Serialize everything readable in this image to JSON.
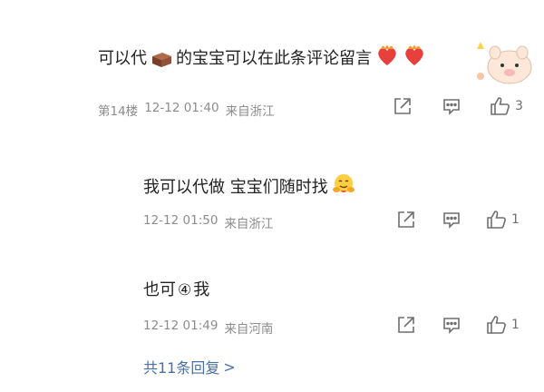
{
  "comments": [
    {
      "text_pre": "可以代",
      "text_post": "的宝宝可以在此条评论留言",
      "emojis": [
        "brick-emoji",
        "heart-fire-emoji",
        "heart-fire-emoji",
        "piggy-sticker"
      ],
      "floor": "第14楼",
      "time": "12-12 01:40",
      "location": "来自浙江",
      "likes": "3"
    },
    {
      "text": "我可以代做 宝宝们随时找",
      "emojis": [
        "hug-face-emoji"
      ],
      "time": "12-12 01:50",
      "location": "来自浙江",
      "likes": "1"
    },
    {
      "text_pre": "也可",
      "circled": "④",
      "text_post": "我",
      "time": "12-12 01:49",
      "location": "来自河南",
      "likes": "1"
    }
  ],
  "replies_link": {
    "label": "共11条回复",
    "chevron": ">"
  },
  "colors": {
    "link": "#4a6fa5",
    "meta": "#8c8c8c",
    "icon": "#6f6f6f",
    "text": "#222222"
  },
  "icons": [
    "share-icon",
    "comment-icon",
    "like-icon"
  ]
}
